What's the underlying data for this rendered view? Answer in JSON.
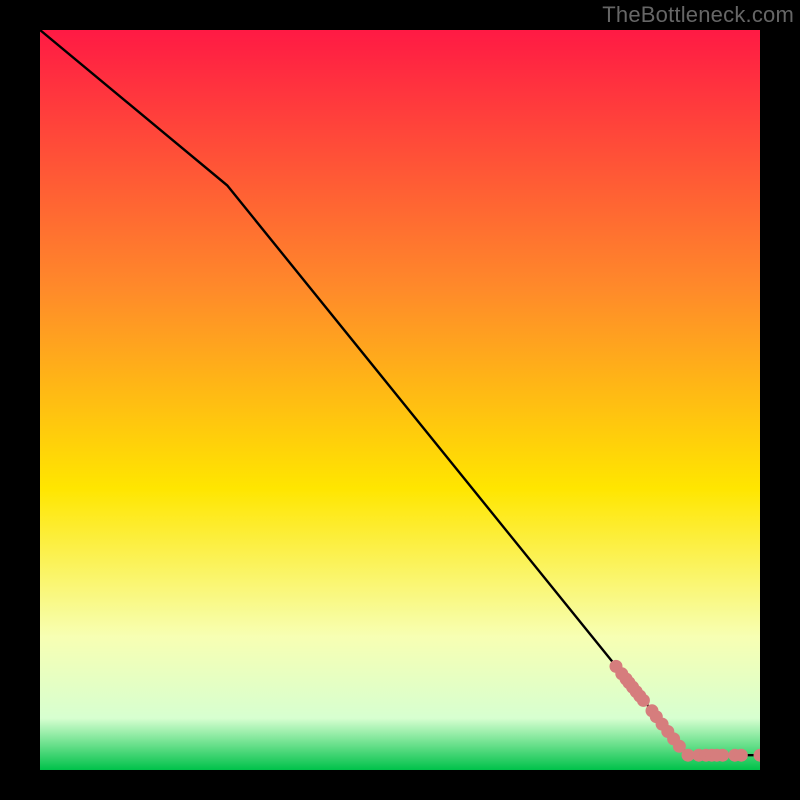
{
  "attribution": "TheBottleneck.com",
  "colors": {
    "background": "#000000",
    "gradient_top": "#ff1a44",
    "gradient_mid_upper": "#ff8a2a",
    "gradient_mid": "#ffe600",
    "gradient_lower": "#f7ffb3",
    "gradient_bottom_light": "#d7ffd0",
    "gradient_bottom": "#00c24a",
    "curve": "#000000",
    "marker_fill": "#d67d7d",
    "marker_stroke": "#a85050"
  },
  "chart_data": {
    "type": "line",
    "title": "",
    "xlabel": "",
    "ylabel": "",
    "xlim": [
      0,
      100
    ],
    "ylim": [
      0,
      100
    ],
    "series": [
      {
        "name": "curve",
        "x": [
          0,
          26,
          90,
          100
        ],
        "y": [
          100,
          79,
          2,
          2
        ]
      }
    ],
    "markers": [
      {
        "x": 80.0,
        "y": 14.0
      },
      {
        "x": 80.8,
        "y": 13.0
      },
      {
        "x": 81.4,
        "y": 12.3
      },
      {
        "x": 81.8,
        "y": 11.8
      },
      {
        "x": 82.3,
        "y": 11.2
      },
      {
        "x": 82.8,
        "y": 10.6
      },
      {
        "x": 83.3,
        "y": 10.0
      },
      {
        "x": 83.8,
        "y": 9.4
      },
      {
        "x": 85.0,
        "y": 8.0
      },
      {
        "x": 85.6,
        "y": 7.2
      },
      {
        "x": 86.4,
        "y": 6.2
      },
      {
        "x": 87.2,
        "y": 5.2
      },
      {
        "x": 88.0,
        "y": 4.2
      },
      {
        "x": 88.8,
        "y": 3.2
      },
      {
        "x": 90.0,
        "y": 2.0
      },
      {
        "x": 91.5,
        "y": 2.0
      },
      {
        "x": 92.5,
        "y": 2.0
      },
      {
        "x": 93.3,
        "y": 2.0
      },
      {
        "x": 94.0,
        "y": 2.0
      },
      {
        "x": 94.8,
        "y": 2.0
      },
      {
        "x": 96.5,
        "y": 2.0
      },
      {
        "x": 97.4,
        "y": 2.0
      },
      {
        "x": 100.0,
        "y": 2.0
      }
    ]
  }
}
